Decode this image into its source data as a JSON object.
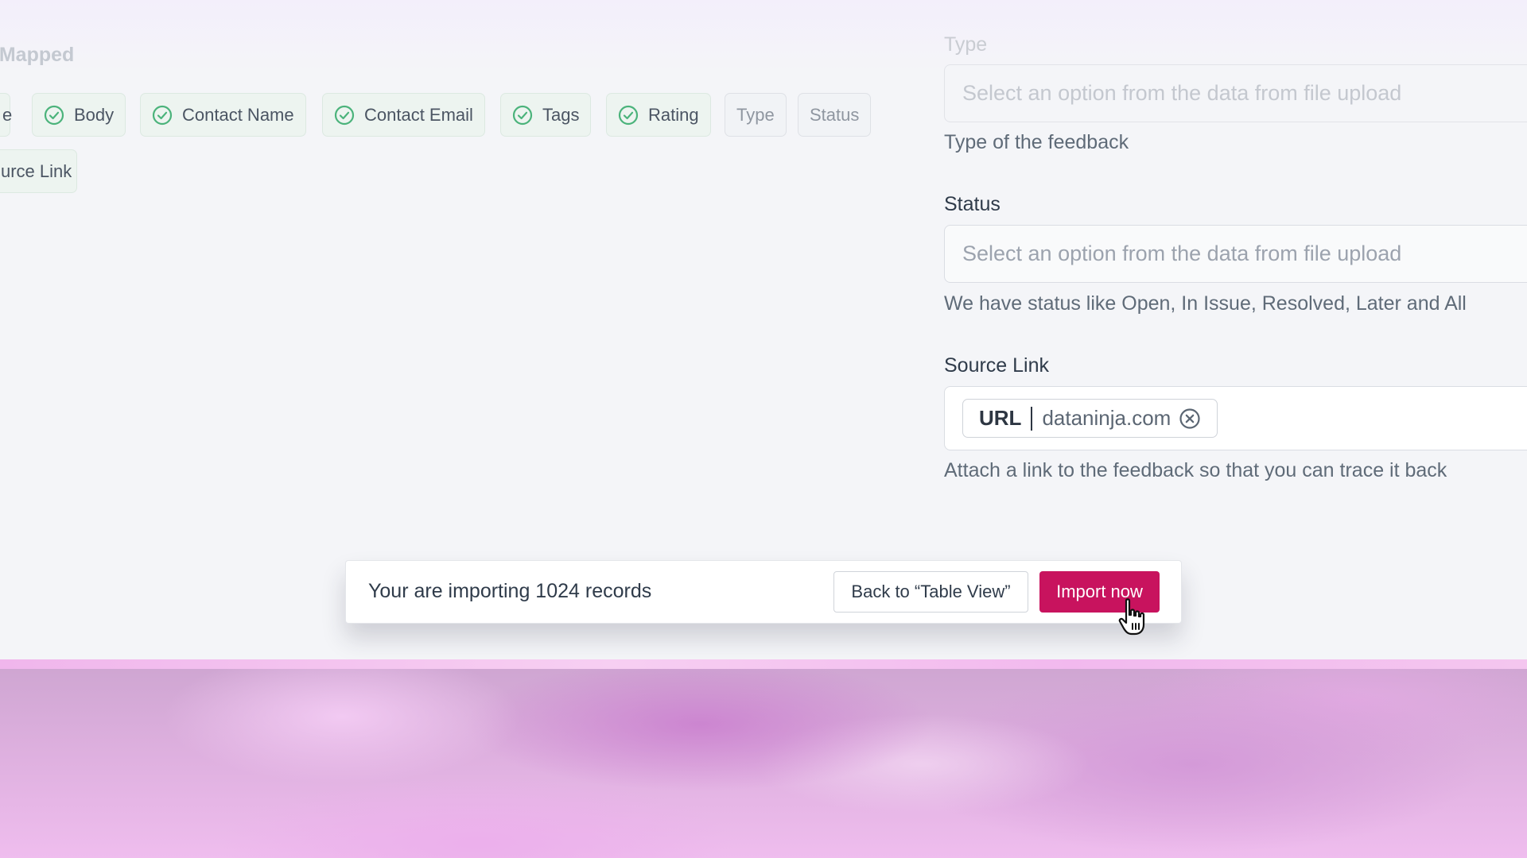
{
  "mapping": {
    "section_title": "a Mapped",
    "chips_row1": [
      {
        "label": "e",
        "mapped": true,
        "icon": "check-circle-icon"
      },
      {
        "label": "Body",
        "mapped": true,
        "icon": "check-circle-icon"
      },
      {
        "label": "Contact Name",
        "mapped": true,
        "icon": "check-circle-icon"
      },
      {
        "label": "Contact Email",
        "mapped": true,
        "icon": "check-circle-icon"
      },
      {
        "label": "Tags",
        "mapped": true,
        "icon": "check-circle-icon"
      },
      {
        "label": "Rating",
        "mapped": true,
        "icon": "check-circle-icon"
      },
      {
        "label": "Type",
        "mapped": false
      },
      {
        "label": "Status",
        "mapped": false
      }
    ],
    "chips_row2": [
      {
        "label": "urce Link",
        "mapped": true
      }
    ]
  },
  "fields": {
    "type": {
      "label": "Type",
      "placeholder": "Select an option from the data from file upload",
      "help": "Type of the feedback"
    },
    "status": {
      "label": "Status",
      "placeholder": "Select an option from the data from file upload",
      "help": "We have status like Open, In Issue, Resolved, Later and All"
    },
    "source_link": {
      "label": "Source Link",
      "chip_kind": "URL",
      "chip_value": "dataninja.com",
      "remove_icon": "close-circle-icon",
      "help": "Attach a link to the feedback so that you can trace it back"
    }
  },
  "import_bar": {
    "text": "Your are importing 1024 records",
    "back_label": "Back to “Table View”",
    "import_label": "Import now",
    "import_color": "#c8135e"
  },
  "cursor": {
    "icon": "hand-pointer-icon"
  },
  "colors": {
    "mapped_check": "#4bb37b",
    "accent": "#c8135e"
  }
}
